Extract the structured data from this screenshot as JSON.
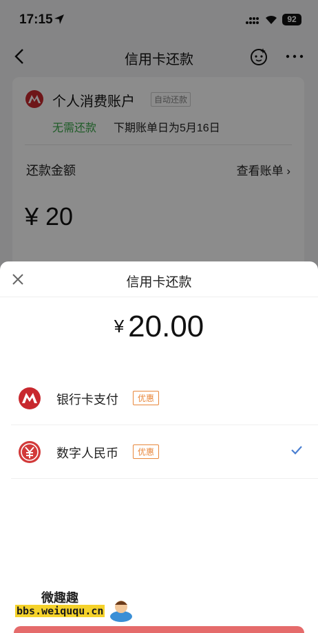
{
  "status_bar": {
    "time": "17:15",
    "battery": "92"
  },
  "nav": {
    "title": "信用卡还款"
  },
  "account": {
    "name": "个人消费账户",
    "auto_tag": "自动还款",
    "status": "无需还款",
    "next_bill": "下期账单日为5月16日",
    "amount_label": "还款金额",
    "view_bill": "查看账单 ›",
    "amount": "¥ 20"
  },
  "sheet": {
    "title": "信用卡还款",
    "currency": "¥",
    "amount": "20.00",
    "options": [
      {
        "label": "银行卡支付",
        "tag": "优惠",
        "icon": "cmb-bank-icon",
        "selected": false
      },
      {
        "label": "数字人民币",
        "tag": "优惠",
        "icon": "ecny-icon",
        "selected": true
      }
    ]
  },
  "watermark": {
    "line1": "微趣趣",
    "line2": "bbs.weiququ.cn"
  },
  "colors": {
    "brand_red": "#c8282e",
    "green": "#3aa84a",
    "tag_orange": "#e8863a",
    "check_blue": "#4a7fd1"
  }
}
